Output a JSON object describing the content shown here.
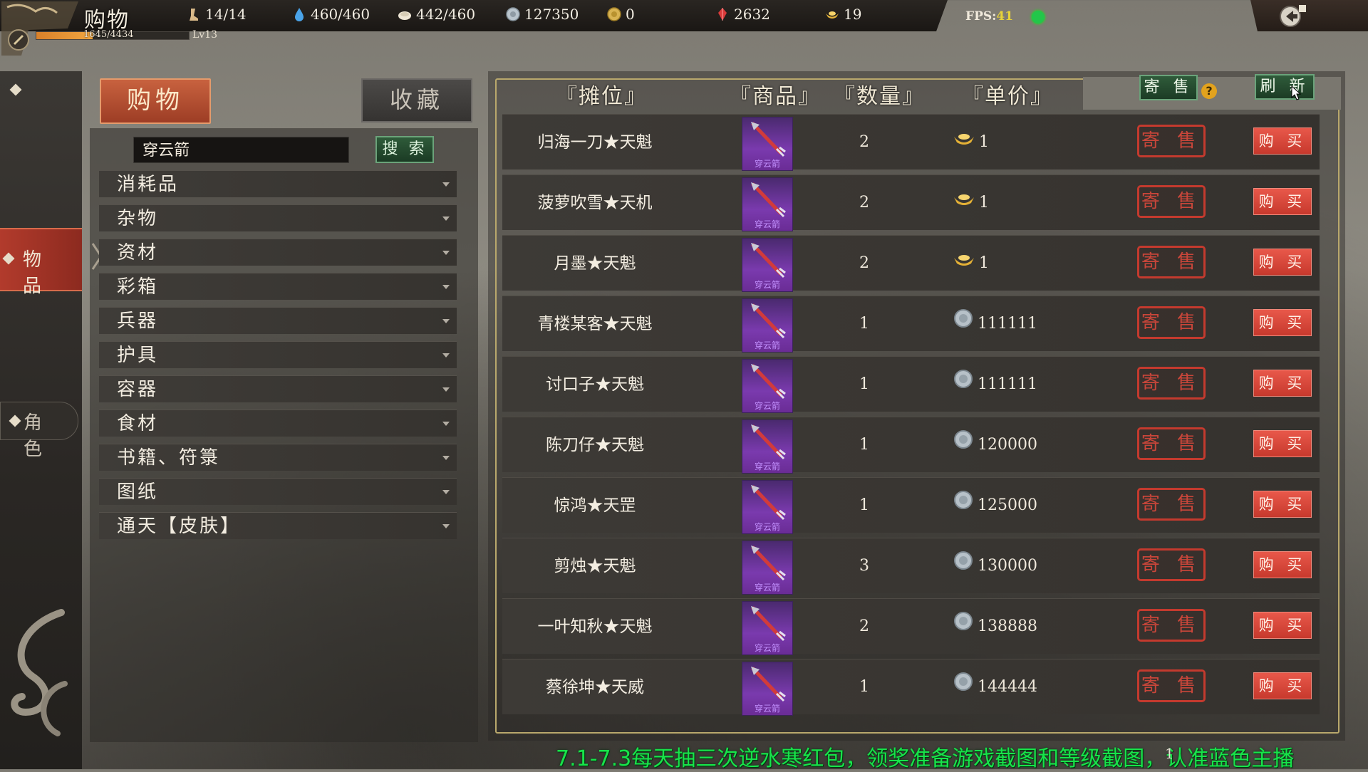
{
  "topbar": {
    "page_title": "购物",
    "hp_text": "1645/4434",
    "hp_fraction": 0.371,
    "level": "Lv13",
    "resources": [
      {
        "name": "stamina",
        "icon": "leg-icon",
        "value": "14/14"
      },
      {
        "name": "water",
        "icon": "water-drop-icon",
        "value": "460/460"
      },
      {
        "name": "food",
        "icon": "bun-icon",
        "value": "442/460"
      },
      {
        "name": "silver",
        "icon": "silver-coin-icon",
        "value": "127350"
      },
      {
        "name": "gold",
        "icon": "gold-coin-icon",
        "value": "0"
      },
      {
        "name": "crystal",
        "icon": "red-crystal-icon",
        "value": "2632"
      },
      {
        "name": "ingot",
        "icon": "gold-ingot-icon",
        "value": "19"
      }
    ],
    "fps_label": "FPS:",
    "fps_value": "41"
  },
  "sidenav": {
    "items_label": "物 品",
    "role_label": "角 色"
  },
  "left_panel": {
    "tab_buy": "购物",
    "tab_favorites": "收藏",
    "search_value": "穿云箭",
    "search_button": "搜 索",
    "categories": [
      "消耗品",
      "杂物",
      "资材",
      "彩箱",
      "兵器",
      "护具",
      "容器",
      "食材",
      "书籍、符箓",
      "图纸",
      "通天【皮肤】"
    ]
  },
  "table": {
    "headers": {
      "stall": "『摊位』",
      "item": "『商品』",
      "quantity": "『数量』",
      "unit_price": "『单价』"
    },
    "consign_top_button": "寄 售",
    "help_icon": "?",
    "refresh_button": "刷 新",
    "item_name": "穿云箭",
    "row_consign_label": "寄 售",
    "row_buy_label": "购 买",
    "rows": [
      {
        "stall": "归海一刀★天魁",
        "quantity": "2",
        "currency": "gold-ingot-icon",
        "price": "1"
      },
      {
        "stall": "菠萝吹雪★天机",
        "quantity": "2",
        "currency": "gold-ingot-icon",
        "price": "1"
      },
      {
        "stall": "月墨★天魁",
        "quantity": "2",
        "currency": "gold-ingot-icon",
        "price": "1"
      },
      {
        "stall": "青楼某客★天魁",
        "quantity": "1",
        "currency": "silver-coin-icon",
        "price": "111111"
      },
      {
        "stall": "讨口子★天魁",
        "quantity": "1",
        "currency": "silver-coin-icon",
        "price": "111111"
      },
      {
        "stall": "陈刀仔★天魁",
        "quantity": "1",
        "currency": "silver-coin-icon",
        "price": "120000"
      },
      {
        "stall": "惊鸿★天罡",
        "quantity": "1",
        "currency": "silver-coin-icon",
        "price": "125000"
      },
      {
        "stall": "剪烛★天魁",
        "quantity": "3",
        "currency": "silver-coin-icon",
        "price": "130000"
      },
      {
        "stall": "一叶知秋★天魁",
        "quantity": "2",
        "currency": "silver-coin-icon",
        "price": "138888"
      },
      {
        "stall": "蔡徐坤★天威",
        "quantity": "1",
        "currency": "silver-coin-icon",
        "price": "144444"
      }
    ]
  },
  "overlay": {
    "ticker": "7.1-7.3每天抽三次逆水寒红包，领奖准备游戏截图和等级截图，认准蓝色主播",
    "page_indicator": "1"
  }
}
